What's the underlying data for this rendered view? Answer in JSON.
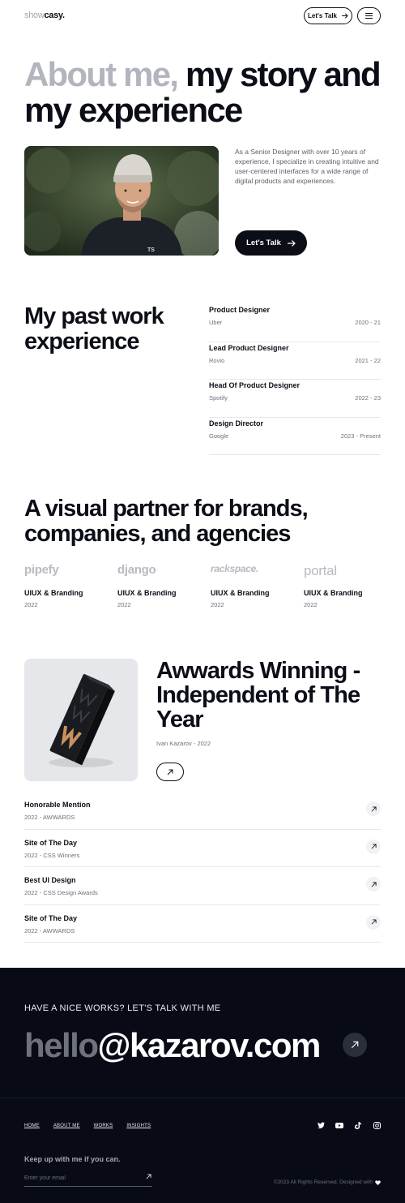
{
  "header": {
    "logo_light": "show",
    "logo_bold": "casy.",
    "talk_label": "Let's Talk"
  },
  "hero": {
    "title_grey": "About me,",
    "title_dark": "my story and my experience",
    "intro": "As a Senior Designer with over 10 years of experience, I specialize in creating intuitive and user-centered interfaces for a wide range of digital products and experiences.",
    "cta_label": "Let's Talk"
  },
  "experience": {
    "title": "My past work experience",
    "items": [
      {
        "role": "Product Designer",
        "company": "Uber",
        "period": "2020 - 21"
      },
      {
        "role": "Lead Product Designer",
        "company": "Rovio",
        "period": "2021 - 22"
      },
      {
        "role": "Head Of Product Designer",
        "company": "Spotify",
        "period": "2022 - 23"
      },
      {
        "role": "Design Director",
        "company": "Google",
        "period": "2023 - Present"
      }
    ]
  },
  "partners": {
    "title": "A visual partner for brands, companies, and agencies",
    "items": [
      {
        "logo": "pipefy",
        "category": "UIUX & Branding",
        "year": "2022"
      },
      {
        "logo": "django",
        "category": "UIUX & Branding",
        "year": "2022"
      },
      {
        "logo": "rackspace.",
        "category": "UIUX & Branding",
        "year": "2022"
      },
      {
        "logo": "portal",
        "category": "UIUX & Branding",
        "year": "2022"
      }
    ]
  },
  "awards": {
    "title": "Awwards Winning - Independent of The Year",
    "subtitle": "Ivan Kazarov - 2022",
    "items": [
      {
        "name": "Honorable Mention",
        "meta": "2022 - AWWARDS"
      },
      {
        "name": "Site of The Day",
        "meta": "2022 - CSS Winners"
      },
      {
        "name": "Best UI Design",
        "meta": "2022 - CSS Design Awards"
      },
      {
        "name": "Site of The Day",
        "meta": "2022 - AWWARDS"
      }
    ]
  },
  "footer": {
    "cta": "HAVE A NICE WORKS? LET'S TALK WITH ME",
    "email_grey": "hello",
    "email_white": "@kazarov.com",
    "nav": [
      "HOME",
      "ABOUT ME",
      "WORKS",
      "INSIGHTS"
    ],
    "social_icons": [
      "twitter-icon",
      "youtube-icon",
      "tiktok-icon",
      "instagram-icon"
    ],
    "newsletter_title": "Keep up with me if you can.",
    "email_placeholder": "Enter your email",
    "copyright": "©2023 All Rights Reserved. Designed with"
  },
  "colors": {
    "ink": "#0b0e17",
    "grey_text": "#b2b5bd",
    "footer_bg": "#080b16"
  }
}
